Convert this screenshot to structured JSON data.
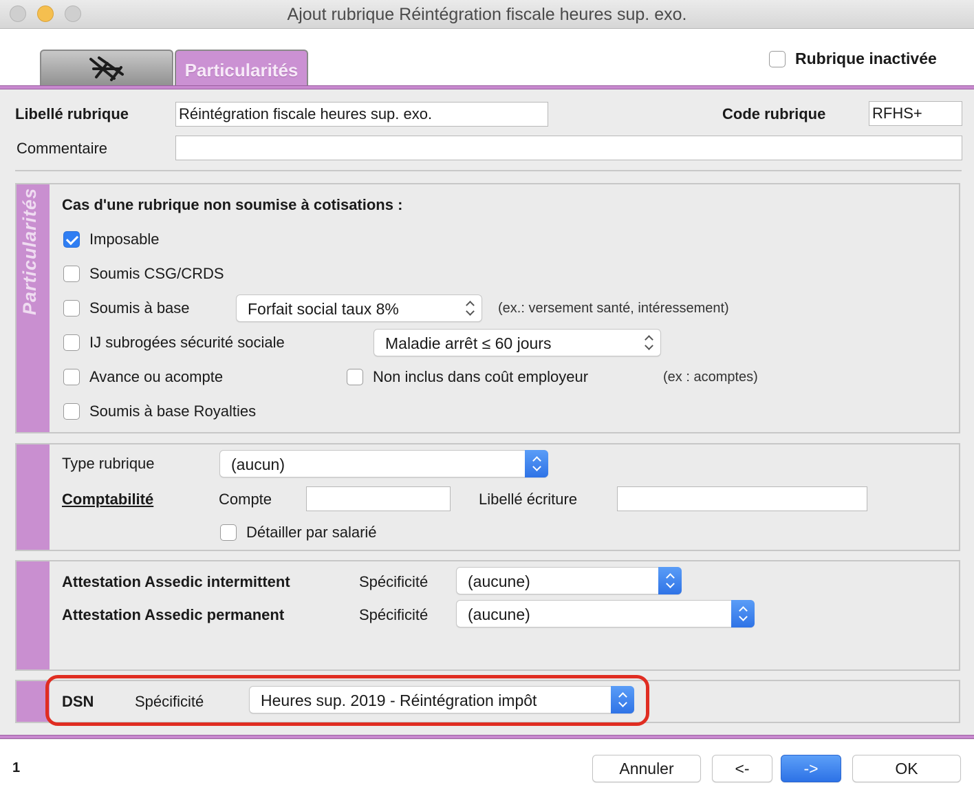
{
  "window": {
    "title": "Ajout rubrique Réintégration fiscale heures sup. exo."
  },
  "tabs": {
    "particularites": "Particularités"
  },
  "header": {
    "inactive_label": "Rubrique inactivée",
    "inactive_checked": false
  },
  "form": {
    "libelle_label": "Libellé rubrique",
    "libelle_value": "Réintégration fiscale heures sup. exo.",
    "code_label": "Code rubrique",
    "code_value": "RFHS+",
    "commentaire_label": "Commentaire",
    "commentaire_value": ""
  },
  "particularites": {
    "side_label": "Particularités",
    "heading": "Cas d'une rubrique non soumise à cotisations :",
    "imposable": {
      "label": "Imposable",
      "checked": true
    },
    "csg": {
      "label": "Soumis CSG/CRDS",
      "checked": false
    },
    "base": {
      "label": "Soumis à base",
      "checked": false,
      "select": "Forfait social taux 8%",
      "hint": "(ex.: versement santé, intéressement)"
    },
    "ij": {
      "label": "IJ subrogées sécurité sociale",
      "checked": false,
      "select": "Maladie arrêt ≤ 60 jours"
    },
    "avance": {
      "label": "Avance ou acompte",
      "checked": false
    },
    "non_inclus": {
      "label": "Non inclus dans coût employeur",
      "checked": false,
      "hint": "(ex : acomptes)"
    },
    "royalties": {
      "label": "Soumis à base Royalties",
      "checked": false
    }
  },
  "compta": {
    "type_label": "Type rubrique",
    "type_value": "(aucun)",
    "section_title": "Comptabilité",
    "compte_label": "Compte",
    "compte_value": "",
    "libelle_label": "Libellé écriture",
    "libelle_value": "",
    "detail_label": "Détailler par salarié",
    "detail_checked": false
  },
  "assedic": {
    "intermittent_label": "Attestation Assedic intermittent",
    "permanent_label": "Attestation Assedic permanent",
    "specificite_label": "Spécificité",
    "intermittent_value": "(aucune)",
    "permanent_value": "(aucune)"
  },
  "dsn": {
    "label": "DSN",
    "specificite_label": "Spécificité",
    "value": "Heures sup. 2019 - Réintégration impôt",
    "highlight_color": "#e02d22"
  },
  "footer": {
    "page_number": "1",
    "cancel": "Annuler",
    "prev": "<-",
    "next": "->",
    "ok": "OK"
  },
  "colors": {
    "accent": "#c98fd0",
    "primary_blue": "#2f73e6"
  }
}
